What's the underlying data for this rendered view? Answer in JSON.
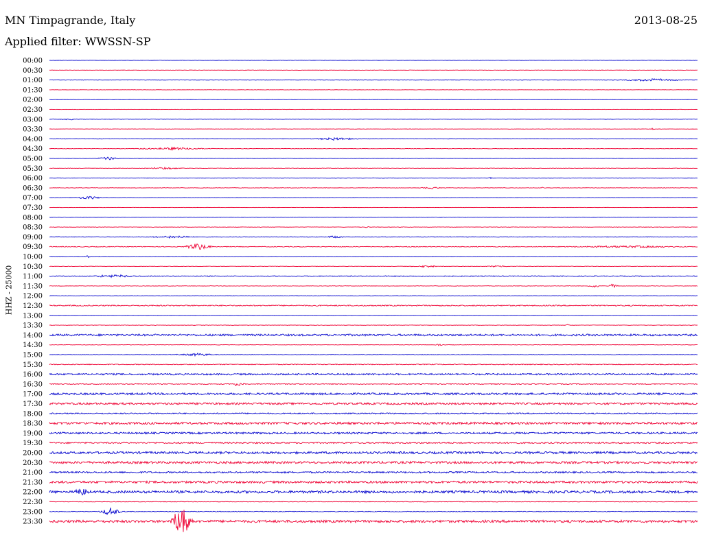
{
  "header": {
    "station": "MN Timpagrande, Italy",
    "filter": "Applied filter: WWSSN-SP",
    "date": "2013-08-25"
  },
  "chart_data": {
    "type": "line",
    "title": "MN Timpagrande, Italy",
    "subtitle": "Applied filter: WWSSN-SP",
    "date": "2013-08-25",
    "ylabel": "HHZ - 25000",
    "xlabel": "",
    "grid": false,
    "colors": {
      "blue": "#0000cc",
      "red": "#ee0033"
    },
    "rows": [
      {
        "label": "00:00",
        "color": "blue",
        "noise": 0.2,
        "events": []
      },
      {
        "label": "00:30",
        "color": "red",
        "noise": 0.2,
        "events": []
      },
      {
        "label": "01:00",
        "color": "blue",
        "noise": 0.3,
        "events": [
          {
            "pos": 0.93,
            "amp": 2,
            "width": 0.06
          }
        ]
      },
      {
        "label": "01:30",
        "color": "red",
        "noise": 0.2,
        "events": []
      },
      {
        "label": "02:00",
        "color": "blue",
        "noise": 0.2,
        "events": []
      },
      {
        "label": "02:30",
        "color": "red",
        "noise": 0.2,
        "events": []
      },
      {
        "label": "03:00",
        "color": "blue",
        "noise": 0.3,
        "events": [
          {
            "pos": 0.03,
            "amp": 1,
            "width": 0.02
          }
        ]
      },
      {
        "label": "03:30",
        "color": "red",
        "noise": 0.2,
        "events": [
          {
            "pos": 0.93,
            "amp": 1.5,
            "width": 0.004
          }
        ]
      },
      {
        "label": "04:00",
        "color": "blue",
        "noise": 0.3,
        "events": [
          {
            "pos": 0.44,
            "amp": 2,
            "width": 0.04
          }
        ]
      },
      {
        "label": "04:30",
        "color": "red",
        "noise": 0.3,
        "events": [
          {
            "pos": 0.19,
            "amp": 2,
            "width": 0.07
          }
        ]
      },
      {
        "label": "05:00",
        "color": "blue",
        "noise": 0.3,
        "events": [
          {
            "pos": 0.09,
            "amp": 2.5,
            "width": 0.02
          }
        ]
      },
      {
        "label": "05:30",
        "color": "red",
        "noise": 0.3,
        "events": [
          {
            "pos": 0.18,
            "amp": 1.5,
            "width": 0.04
          }
        ]
      },
      {
        "label": "06:00",
        "color": "blue",
        "noise": 0.3,
        "events": [
          {
            "pos": 0.68,
            "amp": 1.5,
            "width": 0.005
          }
        ]
      },
      {
        "label": "06:30",
        "color": "red",
        "noise": 0.3,
        "events": [
          {
            "pos": 0.59,
            "amp": 1.5,
            "width": 0.02
          },
          {
            "pos": 0.76,
            "amp": 2,
            "width": 0.004
          }
        ]
      },
      {
        "label": "07:00",
        "color": "blue",
        "noise": 0.3,
        "events": [
          {
            "pos": 0.06,
            "amp": 2.5,
            "width": 0.025
          }
        ]
      },
      {
        "label": "07:30",
        "color": "red",
        "noise": 0.2,
        "events": []
      },
      {
        "label": "08:00",
        "color": "blue",
        "noise": 0.3,
        "events": []
      },
      {
        "label": "08:30",
        "color": "red",
        "noise": 0.3,
        "events": [
          {
            "pos": 0.49,
            "amp": 1.5,
            "width": 0.004
          }
        ]
      },
      {
        "label": "09:00",
        "color": "blue",
        "noise": 0.4,
        "events": [
          {
            "pos": 0.19,
            "amp": 2,
            "width": 0.04
          },
          {
            "pos": 0.44,
            "amp": 1.5,
            "width": 0.02
          }
        ]
      },
      {
        "label": "09:30",
        "color": "red",
        "noise": 0.5,
        "events": [
          {
            "pos": 0.23,
            "amp": 5,
            "width": 0.025
          },
          {
            "pos": 0.9,
            "amp": 1.5,
            "width": 0.12
          }
        ]
      },
      {
        "label": "10:00",
        "color": "blue",
        "noise": 0.3,
        "events": [
          {
            "pos": 0.06,
            "amp": 2,
            "width": 0.004
          }
        ]
      },
      {
        "label": "10:30",
        "color": "red",
        "noise": 0.3,
        "events": [
          {
            "pos": 0.58,
            "amp": 1.5,
            "width": 0.03
          },
          {
            "pos": 0.69,
            "amp": 1.5,
            "width": 0.02
          }
        ]
      },
      {
        "label": "11:00",
        "color": "blue",
        "noise": 0.6,
        "events": [
          {
            "pos": 0.1,
            "amp": 2,
            "width": 0.04
          }
        ]
      },
      {
        "label": "11:30",
        "color": "red",
        "noise": 0.3,
        "events": [
          {
            "pos": 0.84,
            "amp": 3,
            "width": 0.01
          },
          {
            "pos": 0.87,
            "amp": 3,
            "width": 0.01
          }
        ]
      },
      {
        "label": "12:00",
        "color": "blue",
        "noise": 0.3,
        "events": []
      },
      {
        "label": "12:30",
        "color": "red",
        "noise": 0.8,
        "events": []
      },
      {
        "label": "13:00",
        "color": "blue",
        "noise": 0.2,
        "events": []
      },
      {
        "label": "13:30",
        "color": "red",
        "noise": 0.3,
        "events": [
          {
            "pos": 0.8,
            "amp": 1.5,
            "width": 0.004
          }
        ]
      },
      {
        "label": "14:00",
        "color": "blue",
        "noise": 1.4,
        "events": []
      },
      {
        "label": "14:30",
        "color": "red",
        "noise": 0.3,
        "events": [
          {
            "pos": 0.6,
            "amp": 1.5,
            "width": 0.01
          }
        ]
      },
      {
        "label": "15:00",
        "color": "blue",
        "noise": 0.4,
        "events": [
          {
            "pos": 0.23,
            "amp": 2,
            "width": 0.04
          }
        ]
      },
      {
        "label": "15:30",
        "color": "red",
        "noise": 0.6,
        "events": []
      },
      {
        "label": "16:00",
        "color": "blue",
        "noise": 1.2,
        "events": []
      },
      {
        "label": "16:30",
        "color": "red",
        "noise": 0.6,
        "events": [
          {
            "pos": 0.29,
            "amp": 3,
            "width": 0.012
          }
        ]
      },
      {
        "label": "17:00",
        "color": "blue",
        "noise": 1.4,
        "events": []
      },
      {
        "label": "17:30",
        "color": "red",
        "noise": 1.4,
        "events": []
      },
      {
        "label": "18:00",
        "color": "blue",
        "noise": 0.9,
        "events": []
      },
      {
        "label": "18:30",
        "color": "red",
        "noise": 1.6,
        "events": []
      },
      {
        "label": "19:00",
        "color": "blue",
        "noise": 1.4,
        "events": []
      },
      {
        "label": "19:30",
        "color": "red",
        "noise": 1.0,
        "events": []
      },
      {
        "label": "20:00",
        "color": "blue",
        "noise": 1.6,
        "events": []
      },
      {
        "label": "20:30",
        "color": "red",
        "noise": 1.6,
        "events": []
      },
      {
        "label": "21:00",
        "color": "blue",
        "noise": 1.2,
        "events": []
      },
      {
        "label": "21:30",
        "color": "red",
        "noise": 1.6,
        "events": []
      },
      {
        "label": "22:00",
        "color": "blue",
        "noise": 1.8,
        "events": [
          {
            "pos": 0.05,
            "amp": 7,
            "width": 0.012
          }
        ]
      },
      {
        "label": "22:30",
        "color": "red",
        "noise": 0.4,
        "events": [
          {
            "pos": 0.9,
            "amp": 1.5,
            "width": 0.004
          }
        ]
      },
      {
        "label": "23:00",
        "color": "blue",
        "noise": 0.5,
        "events": [
          {
            "pos": 0.095,
            "amp": 6,
            "width": 0.02
          }
        ]
      },
      {
        "label": "23:30",
        "color": "red",
        "noise": 1.8,
        "events": [
          {
            "pos": 0.205,
            "amp": 24,
            "width": 0.02
          }
        ]
      }
    ]
  }
}
